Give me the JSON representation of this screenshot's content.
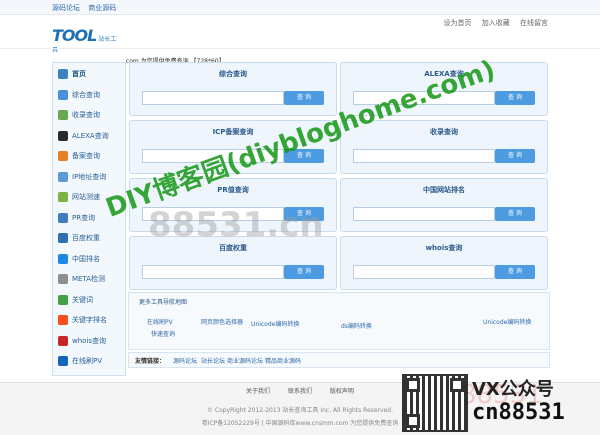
{
  "topbar": {
    "left_links": [
      "源码论坛",
      "商业源码"
    ],
    "right_links": [
      "设为首页",
      "加入收藏",
      "在线留言"
    ]
  },
  "logo": {
    "main": "TOOL",
    "sub": "站长工具"
  },
  "notice": ".com 为您提供免费查询 【728*60】",
  "sidebar": {
    "items": [
      {
        "label": "首页",
        "icon": "home-icon",
        "color": "#3b82c4"
      },
      {
        "label": "综合查询",
        "icon": "search-icon",
        "color": "#4a90d9"
      },
      {
        "label": "收录查询",
        "icon": "record-icon",
        "color": "#6aa84f"
      },
      {
        "label": "ALEXA查询",
        "icon": "alexa-icon",
        "color": "#2b2b2b"
      },
      {
        "label": "备案查询",
        "icon": "icp-icon",
        "color": "#e67e22"
      },
      {
        "label": "IP地址查询",
        "icon": "ip-icon",
        "color": "#5b9bd5"
      },
      {
        "label": "网站测速",
        "icon": "speed-icon",
        "color": "#7cb342"
      },
      {
        "label": "PR查询",
        "icon": "pr-icon",
        "color": "#3f7fbf"
      },
      {
        "label": "百度权重",
        "icon": "baidu-icon",
        "color": "#2f6fb3"
      },
      {
        "label": "中国排名",
        "icon": "rank-icon",
        "color": "#1e88e5"
      },
      {
        "label": "META检测",
        "icon": "meta-icon",
        "color": "#8e8e8e"
      },
      {
        "label": "关键词",
        "icon": "keyword-icon",
        "color": "#43a047"
      },
      {
        "label": "关键字排名",
        "icon": "keyword-rank-icon",
        "color": "#f4511e"
      },
      {
        "label": "whois查询",
        "icon": "whois-icon",
        "color": "#c62828"
      },
      {
        "label": "在线刷PV",
        "icon": "pv-icon",
        "color": "#1565c0"
      }
    ]
  },
  "panels": [
    {
      "title": "综合查询",
      "button": "查 询"
    },
    {
      "title": "ALEXA查询",
      "button": "查 询"
    },
    {
      "title": "ICP备案查询",
      "button": "查 询"
    },
    {
      "title": "收录查询",
      "button": "查 询"
    },
    {
      "title": "PR值查询",
      "button": "查 询"
    },
    {
      "title": "中国网站排名",
      "button": "查 询"
    },
    {
      "title": "百度权重",
      "button": "查 询"
    },
    {
      "title": "whois查询",
      "button": "查 询"
    }
  ],
  "navbox": {
    "title": "更多工具导航地图",
    "links": [
      "在线刷PV",
      "网页颜色选择器",
      "Unicode编码转换",
      "ds编码转换",
      "Unicode编码转换",
      "快速查询"
    ]
  },
  "friends": {
    "label": "友情链接：",
    "links": [
      "源码论坛",
      "站长论坛",
      "商业源码论坛",
      "精品商业源码"
    ]
  },
  "footer": {
    "links": [
      "关于我们",
      "联系我们",
      "版权声明"
    ],
    "copyright": "© CopyRight 2012-2013 站长查询工具  Inc. All Rights Reserved.",
    "icp": "粤ICP备12052229号 | 中国源码库www.cnsmm.com 为您提供免费查询"
  },
  "watermarks": {
    "green": "DIY博客园(diybloghome.com)",
    "grey": "88531.cn",
    "pink": "88531",
    "vx": "VX公众号",
    "cn": "cn88531"
  }
}
